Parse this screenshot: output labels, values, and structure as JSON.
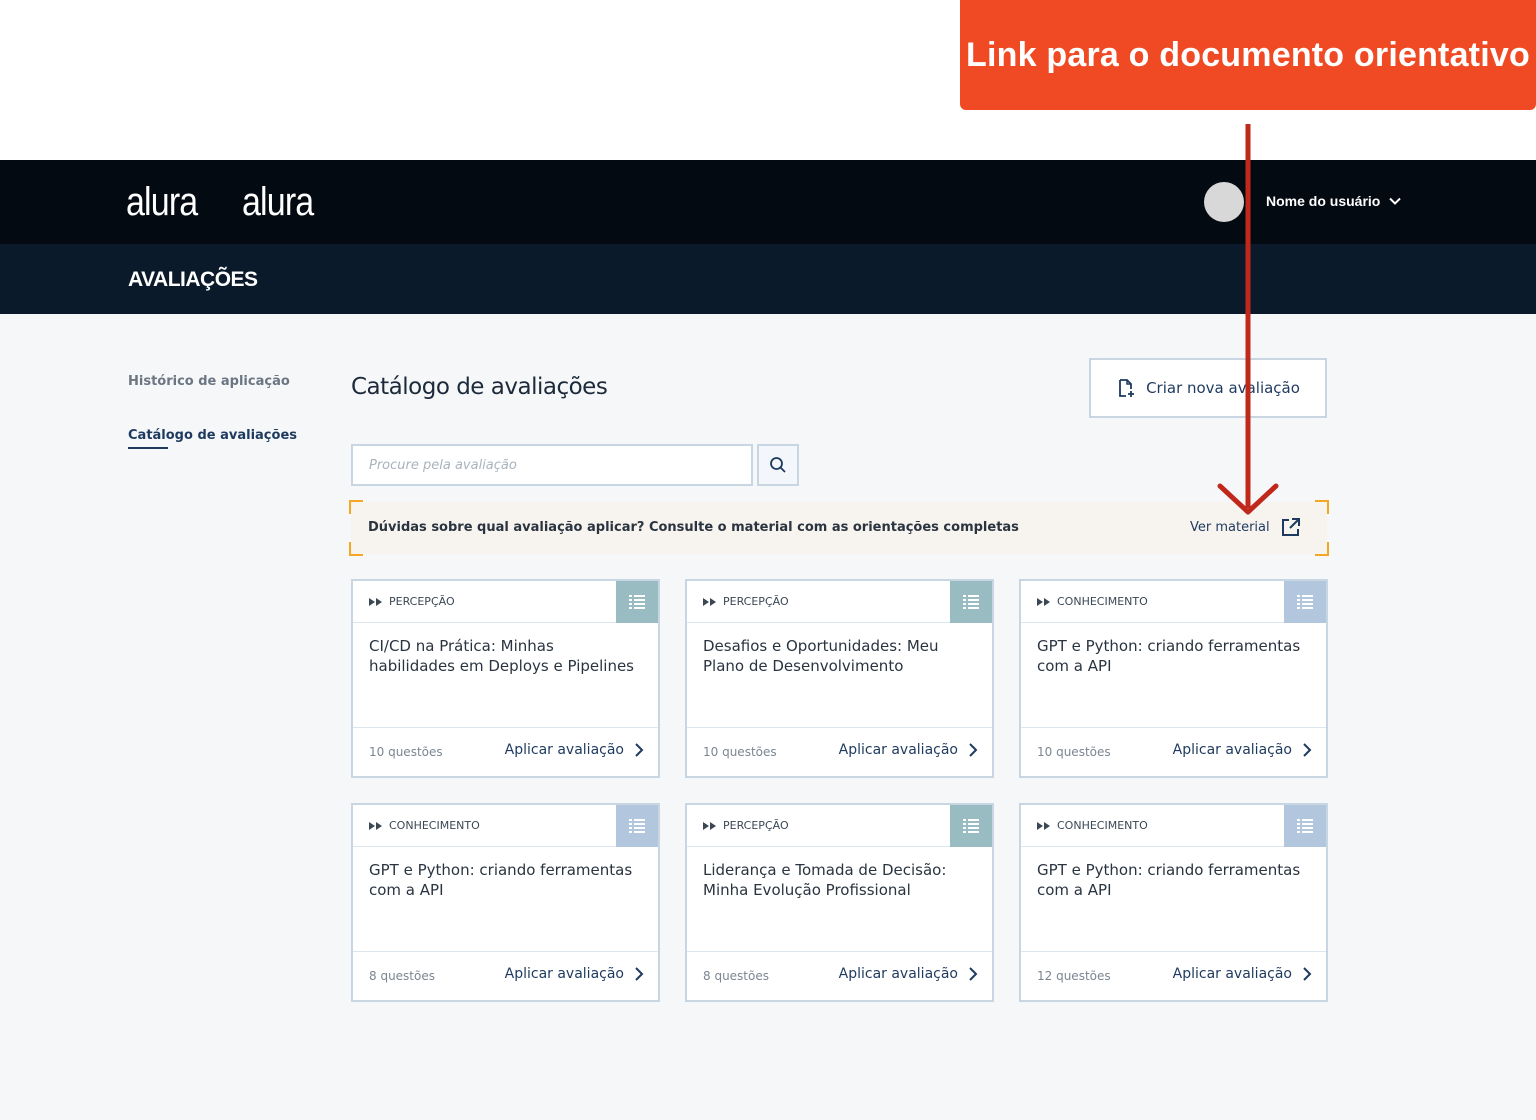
{
  "callout": {
    "text": "Link para o documento orientativo"
  },
  "header": {
    "logos": [
      "alura",
      "alura"
    ],
    "user_name": "Nome do usuário"
  },
  "subheader": {
    "title": "AVALIAÇÕES"
  },
  "sidebar": {
    "items": [
      {
        "label": "Histórico de aplicação"
      },
      {
        "label": "Catálogo de avaliações"
      }
    ]
  },
  "main": {
    "title": "Catálogo de avaliações",
    "new_button_label": "Criar nova avaliação",
    "search_placeholder": "Procure pela avaliação",
    "notice": {
      "text": "Dúvidas sobre qual avaliação aplicar? Consulte o material com as orientações completas",
      "link_label": "Ver material"
    },
    "cards": [
      {
        "category": "PERCEPÇÃO",
        "title": "CI/CD na Prática: Minhas habilidades em Deploys e Pipelines",
        "questions": "10 questões",
        "action": "Aplicar avaliação"
      },
      {
        "category": "PERCEPÇÃO",
        "title": "Desafios e Oportunidades: Meu Plano de Desenvolvimento",
        "questions": "10 questões",
        "action": "Aplicar avaliação"
      },
      {
        "category": "CONHECIMENTO",
        "title": "GPT e Python: criando ferramentas com a API",
        "questions": "10 questões",
        "action": "Aplicar avaliação"
      },
      {
        "category": "CONHECIMENTO",
        "title": "GPT e Python: criando ferramentas com a API",
        "questions": "8 questões",
        "action": "Aplicar avaliação"
      },
      {
        "category": "PERCEPÇÃO",
        "title": "Liderança e Tomada de Decisão: Minha Evolução Profissional",
        "questions": "8 questões",
        "action": "Aplicar avaliação"
      },
      {
        "category": "CONHECIMENTO",
        "title": "GPT e Python: criando ferramentas com a API",
        "questions": "12 questões",
        "action": "Aplicar avaliação"
      }
    ]
  },
  "colors": {
    "callout": "#f04a24",
    "topbar": "#040a12",
    "subbar": "#0a1a2a",
    "accent": "#1e3a5f",
    "notice_corners": "#f5a623",
    "arrow": "#c0281c",
    "category_percepcao": "#98bcc2",
    "category_conhecimento": "#b2c7dd"
  },
  "icons": [
    "external-link-icon",
    "search-icon",
    "new-document-icon",
    "list-icon",
    "chevron-right-icon",
    "chevron-down-icon",
    "double-play-icon"
  ]
}
